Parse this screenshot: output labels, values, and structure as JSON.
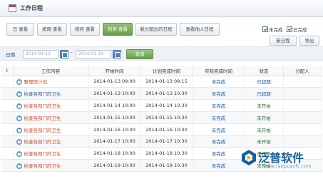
{
  "header": {
    "title": "工作日程"
  },
  "tabs": [
    {
      "label": "日 查看",
      "active": false
    },
    {
      "label": "按周 查看",
      "active": false
    },
    {
      "label": "按月 查看",
      "active": false
    },
    {
      "label": "列表 查看",
      "active": true
    },
    {
      "label": "我分配出的日程",
      "active": false
    },
    {
      "label": "查看他人日程",
      "active": false
    }
  ],
  "filters": {
    "unfinished_label": "未完成",
    "finished_label": "已完成",
    "date_label": "日期",
    "start_date": "2014-01-13",
    "end_date": "2014-01-19",
    "dash": "-",
    "query_button": "查询"
  },
  "actions": {
    "new_schedule": "新日程",
    "export": "导出"
  },
  "table": {
    "columns": [
      "!",
      "工作内容",
      "开始时间",
      "计划完成时间",
      "实际完成时间",
      "状态",
      "分配人"
    ],
    "rows": [
      {
        "content": "整理周计划",
        "start": "2014-01-13 09:00",
        "plan_end": "2014-01-13 09:15",
        "actual_end": "未完成",
        "status": "已超期",
        "assigner": "",
        "tone": "red"
      },
      {
        "content": "检查各部门的卫生",
        "start": "2014-01-13 10:00",
        "plan_end": "2014-01-13 10:30",
        "actual_end": "未完成",
        "status": "已超期",
        "assigner": "",
        "tone": "normal"
      },
      {
        "content": "检查各部门的卫生",
        "start": "2014-01-14 10:00",
        "plan_end": "2014-01-14 10:30",
        "actual_end": "未完成",
        "status": "未开始",
        "assigner": "",
        "tone": "red"
      },
      {
        "content": "检查各部门的卫生",
        "start": "2014-01-15 10:00",
        "plan_end": "2014-01-15 10:30",
        "actual_end": "未完成",
        "status": "未开始",
        "assigner": "",
        "tone": "red"
      },
      {
        "content": "检查各部门的卫生",
        "start": "2014-01-16 10:00",
        "plan_end": "2014-01-16 10:30",
        "actual_end": "未完成",
        "status": "未开始",
        "assigner": "",
        "tone": "red"
      },
      {
        "content": "检查各部门的卫生",
        "start": "2014-01-17 10:00",
        "plan_end": "2014-01-17 10:30",
        "actual_end": "未完成",
        "status": "未开始",
        "assigner": "",
        "tone": "red"
      },
      {
        "content": "检查各部门的卫生",
        "start": "2014-01-18 10:00",
        "plan_end": "2014-01-18 10:30",
        "actual_end": "未完成",
        "status": "未开始",
        "assigner": "",
        "tone": "red"
      },
      {
        "content": "检查各部门的卫生",
        "start": "2014-01-19 10:00",
        "plan_end": "2014-01-19 10:30",
        "actual_end": "未完成",
        "status": "未开始",
        "assigner": "",
        "tone": "red"
      }
    ]
  },
  "watermark": {
    "brand": "泛普软件",
    "url": "www.fanpusoft.com"
  },
  "colors": {
    "accent": "#6a9e4f",
    "overdue": "#c23a20",
    "notstarted": "#2a6a2a",
    "link": "#1f5fa8"
  }
}
